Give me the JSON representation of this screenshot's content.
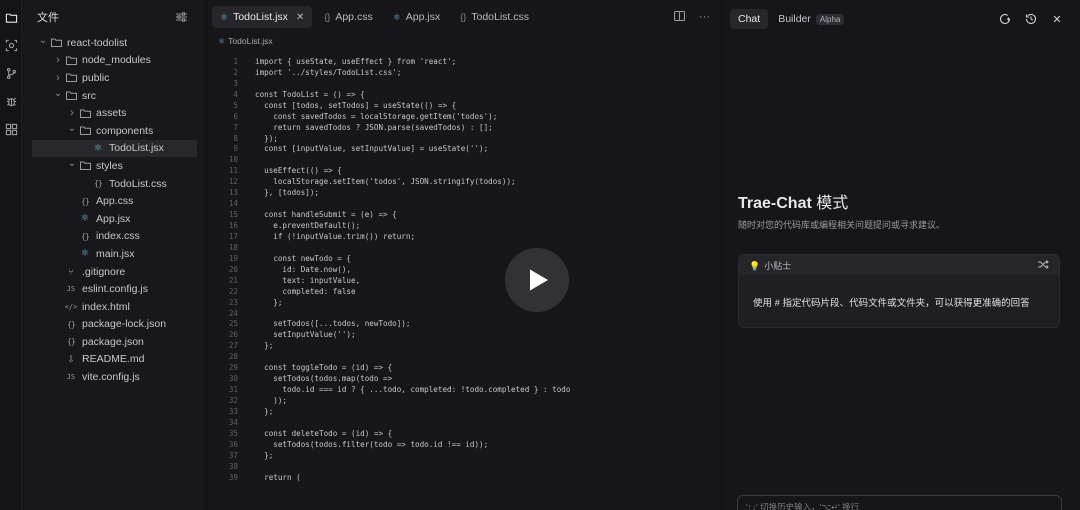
{
  "explorer": {
    "title": "文件",
    "items": [
      {
        "label": "react-todolist",
        "type": "folder",
        "expanded": true,
        "depth": 0
      },
      {
        "label": "node_modules",
        "type": "folder",
        "expanded": false,
        "depth": 1
      },
      {
        "label": "public",
        "type": "folder",
        "expanded": false,
        "depth": 1
      },
      {
        "label": "src",
        "type": "folder",
        "expanded": true,
        "depth": 1
      },
      {
        "label": "assets",
        "type": "folder",
        "expanded": false,
        "depth": 2
      },
      {
        "label": "components",
        "type": "folder",
        "expanded": true,
        "depth": 2
      },
      {
        "label": "TodoList.jsx",
        "type": "react",
        "depth": 3,
        "selected": true
      },
      {
        "label": "styles",
        "type": "folder",
        "expanded": true,
        "depth": 2
      },
      {
        "label": "TodoList.css",
        "type": "css",
        "depth": 3
      },
      {
        "label": "App.css",
        "type": "css",
        "depth": 2
      },
      {
        "label": "App.jsx",
        "type": "react",
        "depth": 2
      },
      {
        "label": "index.css",
        "type": "css",
        "depth": 2
      },
      {
        "label": "main.jsx",
        "type": "react",
        "depth": 2
      },
      {
        "label": ".gitignore",
        "type": "git",
        "depth": 1
      },
      {
        "label": "eslint.config.js",
        "type": "js",
        "depth": 1
      },
      {
        "label": "index.html",
        "type": "html",
        "depth": 1
      },
      {
        "label": "package-lock.json",
        "type": "json",
        "depth": 1
      },
      {
        "label": "package.json",
        "type": "json",
        "depth": 1
      },
      {
        "label": "README.md",
        "type": "md",
        "depth": 1
      },
      {
        "label": "vite.config.js",
        "type": "js",
        "depth": 1
      }
    ]
  },
  "editor": {
    "tabs": [
      {
        "label": "TodoList.jsx",
        "type": "react",
        "active": true
      },
      {
        "label": "App.css",
        "type": "css"
      },
      {
        "label": "App.jsx",
        "type": "react"
      },
      {
        "label": "TodoList.css",
        "type": "css"
      }
    ],
    "breadcrumb": "TodoList.jsx",
    "lines": [
      "import { useState, useEffect } from 'react';",
      "import '../styles/TodoList.css';",
      "",
      "const TodoList = () => {",
      "  const [todos, setTodos] = useState(() => {",
      "    const savedTodos = localStorage.getItem('todos');",
      "    return savedTodos ? JSON.parse(savedTodos) : [];",
      "  });",
      "  const [inputValue, setInputValue] = useState('');",
      "",
      "  useEffect(() => {",
      "    localStorage.setItem('todos', JSON.stringify(todos));",
      "  }, [todos]);",
      "",
      "  const handleSubmit = (e) => {",
      "    e.preventDefault();",
      "    if (!inputValue.trim()) return;",
      "",
      "    const newTodo = {",
      "      id: Date.now(),",
      "      text: inputValue,",
      "      completed: false",
      "    };",
      "",
      "    setTodos([...todos, newTodo]);",
      "    setInputValue('');",
      "  };",
      "",
      "  const toggleTodo = (id) => {",
      "    setTodos(todos.map(todo =>",
      "      todo.id === id ? { ...todo, completed: !todo.completed } : todo",
      "    ));",
      "  };",
      "",
      "  const deleteTodo = (id) => {",
      "    setTodos(todos.filter(todo => todo.id !== id));",
      "  };",
      "",
      "  return ("
    ]
  },
  "chat": {
    "tab_chat": "Chat",
    "tab_builder": "Builder",
    "builder_badge": "Alpha",
    "title": "Trae-Chat",
    "title_mode": "模式",
    "subtitle": "随时对您的代码库或编程相关问题提问或寻求建议。",
    "tip_label": "小贴士",
    "tip_text": "使用 # 指定代码片段、代码文件或文件夹，可以获得更准确的回答",
    "input_placeholder": "'↑↓' 切换历史输入，'⌥↵' 换行"
  }
}
